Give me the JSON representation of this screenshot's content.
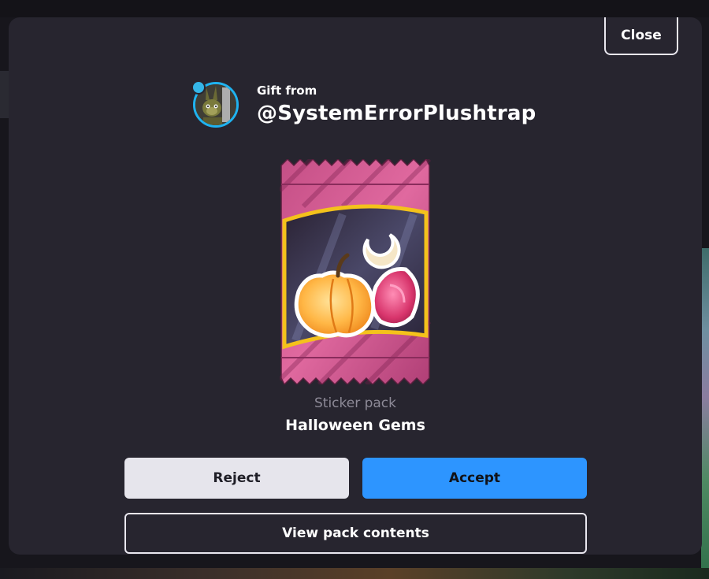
{
  "dialog": {
    "close_label": "Close",
    "gift_from_label": "Gift from",
    "sender_username": "@SystemErrorPlushtrap",
    "item_type": "Sticker pack",
    "item_name": "Halloween Gems",
    "reject_label": "Reject",
    "accept_label": "Accept",
    "view_contents_label": "View pack contents"
  },
  "icons": {
    "avatar": "avatar-image",
    "pack": "sticker-pack-art"
  },
  "colors": {
    "modal_bg": "#27252f",
    "accent_blue": "#2d95ff",
    "avatar_ring": "#1fb3f0",
    "reject_bg": "#e6e5ec"
  }
}
